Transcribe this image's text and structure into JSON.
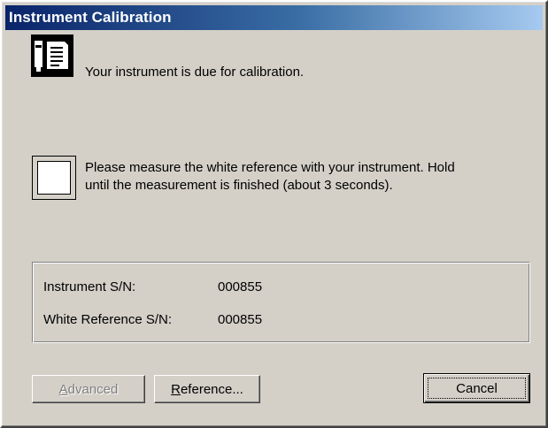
{
  "window": {
    "title": "Instrument Calibration"
  },
  "messages": {
    "due_text": "Your instrument is due for calibration.",
    "measure_line1": "Please measure the white reference with your instrument.  Hold",
    "measure_line2": "until the measurement is finished (about 3 seconds)."
  },
  "info": {
    "instrument_label": "Instrument S/N:",
    "instrument_value": "000855",
    "reference_label": "White Reference S/N:",
    "reference_value": "000855"
  },
  "buttons": {
    "advanced": {
      "mnemonic": "A",
      "rest": "dvanced",
      "enabled": false
    },
    "reference": {
      "mnemonic": "R",
      "rest": "eference...",
      "enabled": true
    },
    "cancel": {
      "label": "Cancel",
      "default": true
    }
  },
  "icons": {
    "instrument": "instrument-device-icon",
    "white_swatch": "white-reference-swatch"
  },
  "colors": {
    "title_start": "#0a246a",
    "title_end": "#a6caf0",
    "face": "#d4d0c8"
  }
}
